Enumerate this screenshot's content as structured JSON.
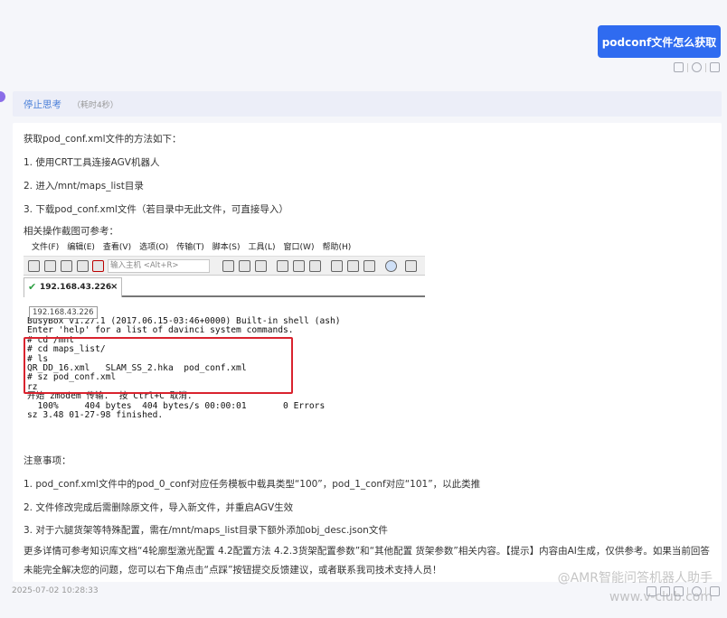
{
  "user_message": {
    "text": "podconf文件怎么获取"
  },
  "thinking": {
    "label": "停止思考",
    "time": "（耗时4秒）"
  },
  "answer": {
    "intro": "获取pod_conf.xml文件的方法如下：",
    "steps": [
      "1. 使用CRT工具连接AGV机器人",
      "2. 进入/mnt/maps_list目录",
      "3. 下载pod_conf.xml文件（若目录中无此文件，可直接导入）"
    ],
    "screenshot_caption": "相关操作截图可参考：",
    "notes_title": "注意事项：",
    "notes": [
      "1. pod_conf.xml文件中的pod_0_conf对应任务模板中载具类型“100”，pod_1_conf对应“101”，以此类推",
      "2. 文件修改完成后需删除原文件，导入新文件，并重启AGV生效",
      "3. 对于六腿货架等特殊配置，需在/mnt/maps_list目录下额外添加obj_desc.json文件"
    ],
    "footer": "更多详情可参考知识库文档“4轮廓型激光配置 4.2配置方法 4.2.3货架配置参数”和“其他配置 货架参数”相关内容。【提示】内容由AI生成，仅供参考。如果当前回答未能完全解决您的问题，您可以右下角点击“点踩”按钮提交反馈建议，或者联系我司技术支持人员！"
  },
  "terminal_screenshot": {
    "menu": [
      "文件(F)",
      "编辑(E)",
      "查看(V)",
      "选项(O)",
      "传输(T)",
      "脚本(S)",
      "工具(L)",
      "窗口(W)",
      "帮助(H)"
    ],
    "host_placeholder": "输入主机 <Alt+R>",
    "tab_label": "192.168.43.226",
    "tab_close": "×",
    "tooltip": "192.168.43.226",
    "lines": [
      "BusyBox v1.27.1 (2017.06.15-03:46+0000) Built-in shell (ash)",
      "Enter 'help' for a list of davinci system commands.",
      "",
      "# cd /mnt",
      "# cd maps_list/",
      "# ls",
      "QR_DD_16.xml   SLAM_SS_2.hka  pod_conf.xml",
      "# sz pod_conf.xml",
      "rz",
      "开始 zmodem 传输.  按 Ctrl+C 取消.",
      "  100%     404 bytes  404 bytes/s 00:00:01       0 Errors",
      "",
      "sz 3.48 01-27-98 finished."
    ]
  },
  "timestamp": "2025-07-02 10:28:33",
  "watermark": {
    "line1": "@AMR智能问答机器人助手",
    "line2": "www.v-club.com"
  },
  "colors": {
    "primary": "#2f6bf0",
    "think_label": "#4a7fd8",
    "highlight": "#d9232e",
    "tab_check": "#2ea043"
  }
}
